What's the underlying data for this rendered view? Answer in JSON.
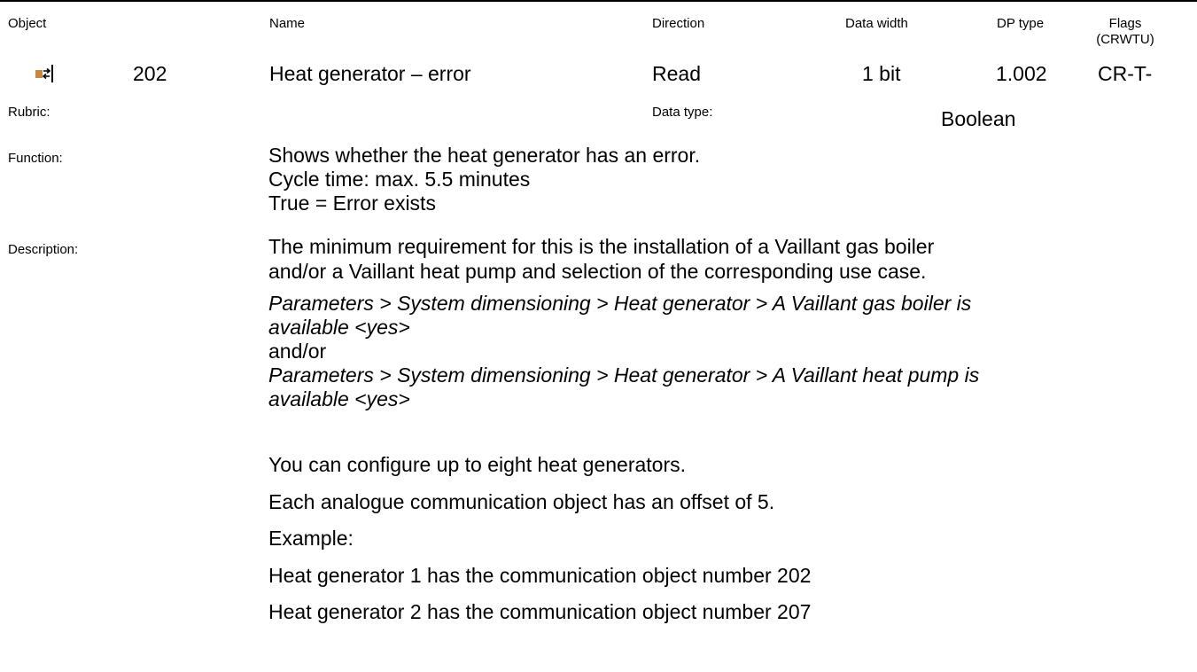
{
  "header": {
    "object": "Object",
    "name": "Name",
    "direction": "Direction",
    "data_width": "Data width",
    "dp_type": "DP type",
    "flags_1": "Flags",
    "flags_2": "(CRWTU)"
  },
  "row": {
    "icon": "object-io-icon",
    "number": "202",
    "name": "Heat generator – error",
    "direction": "Read",
    "data_width": "1 bit",
    "dp_type": "1.002",
    "flags": "CR-T-"
  },
  "rubric_label": "Rubric:",
  "data_type_label": "Data type:",
  "data_type_value": "Boolean",
  "function_label": "Function:",
  "function_lines": [
    "Shows whether the heat generator has an error.",
    "Cycle time: max. 5.5 minutes",
    "True = Error exists"
  ],
  "description_label": "Description:",
  "description_lines": [
    "The minimum requirement for this is the installation of a Vaillant gas boiler",
    "and/or a Vaillant heat pump and selection of the corresponding use case."
  ],
  "param1_line1": "Parameters > System dimensioning > Heat generator > A Vaillant gas boiler is",
  "param1_line2": "available <yes>",
  "and_or": "and/or",
  "param2_line1": "Parameters > System dimensioning > Heat generator > A Vaillant heat pump is",
  "param2_line2": "available <yes>",
  "notes": [
    "You can configure up to eight heat generators.",
    "Each analogue communication object has an offset of 5.",
    "Example:",
    "Heat generator 1 has the communication object number 202",
    "Heat generator 2 has the communication object number 207"
  ],
  "colors": {
    "icon_brown": "#c8873e",
    "text": "#000000"
  }
}
